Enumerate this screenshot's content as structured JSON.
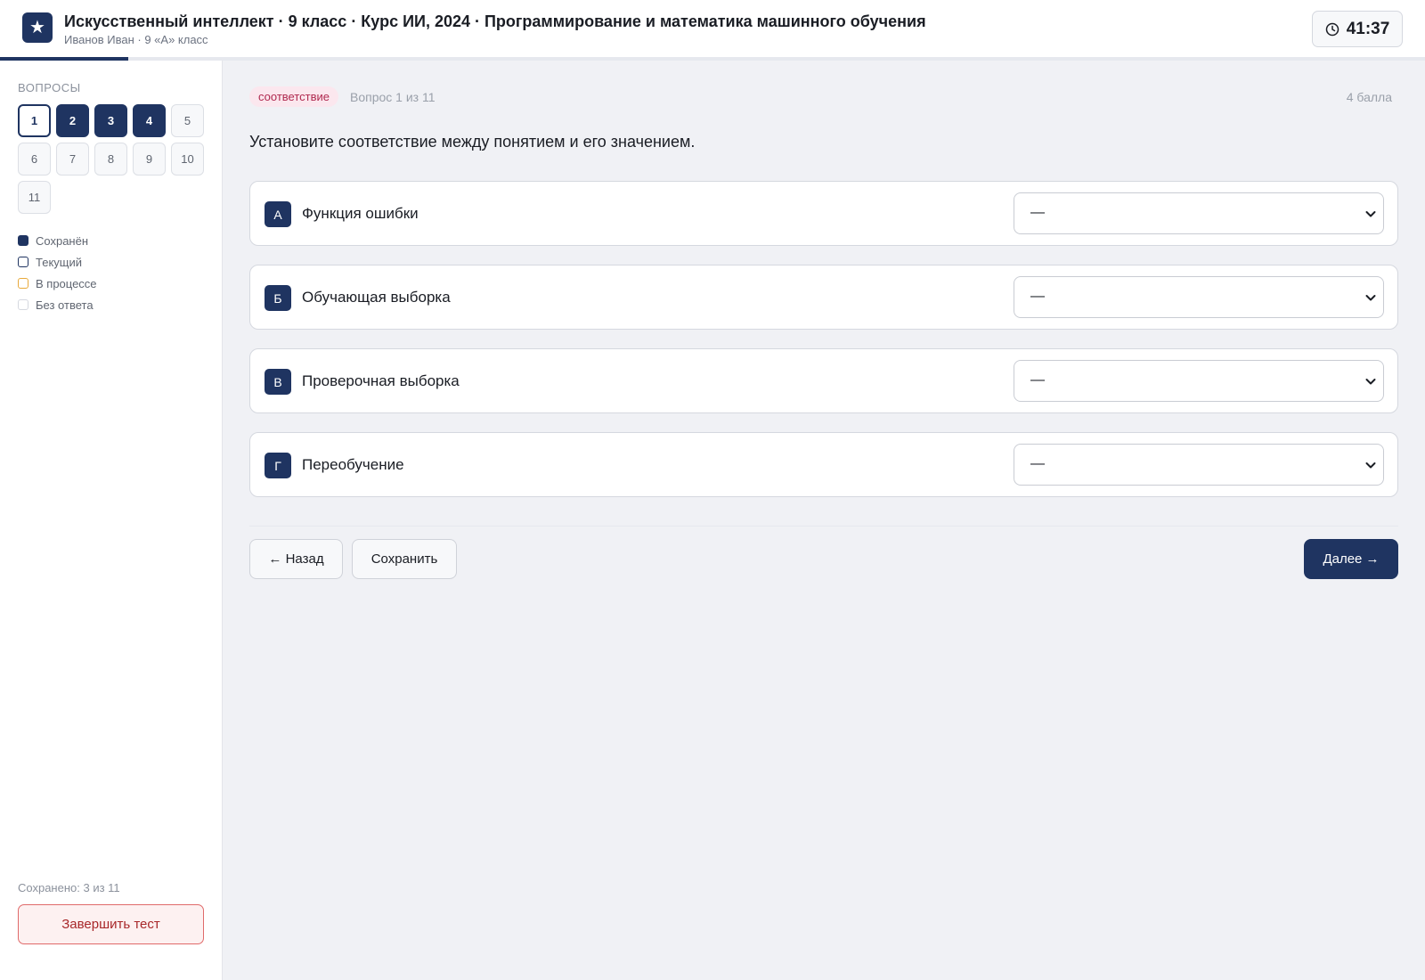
{
  "header": {
    "title": "Искусственный интеллект · 9 класс · Курс ИИ, 2024 · Программирование и математика машинного обучения",
    "subtitle": "Иванов Иван · 9 «А» класс",
    "logo_icon": "star-icon",
    "timer": "41:37",
    "progress": 0.09
  },
  "sidebar": {
    "heading": "ВОПРОСЫ",
    "questions": [
      {
        "label": "1",
        "state": "current"
      },
      {
        "label": "2",
        "state": "saved"
      },
      {
        "label": "3",
        "state": "saved"
      },
      {
        "label": "4",
        "state": "saved"
      },
      {
        "label": "5",
        "state": "empty"
      },
      {
        "label": "6",
        "state": "empty"
      },
      {
        "label": "7",
        "state": "empty"
      },
      {
        "label": "8",
        "state": "empty"
      },
      {
        "label": "9",
        "state": "empty"
      },
      {
        "label": "10",
        "state": "empty"
      },
      {
        "label": "11",
        "state": "empty"
      }
    ],
    "legend": [
      {
        "label": "Сохранён",
        "kind": "saved"
      },
      {
        "label": "Текущий",
        "kind": "current"
      },
      {
        "label": "В процессе",
        "kind": "progress"
      },
      {
        "label": "Без ответа",
        "kind": "empty"
      }
    ],
    "saved_count": "Сохранено: 3 из 11",
    "finish_label": "Завершить тест"
  },
  "question": {
    "type_tag": "соответствие",
    "counter": "Вопрос 1 из 11",
    "points": "4 балла",
    "text": "Установите соответствие между понятием и его значением.",
    "rows": [
      {
        "letter": "А",
        "concept": "Функция ошибки",
        "selected": "—"
      },
      {
        "letter": "Б",
        "concept": "Обучающая выборка",
        "selected": "—"
      },
      {
        "letter": "В",
        "concept": "Проверочная выборка",
        "selected": "—"
      },
      {
        "letter": "Г",
        "concept": "Переобучение",
        "selected": "—"
      }
    ]
  },
  "nav": {
    "back_label": "← Назад",
    "save_label": "Сохранить",
    "next_label": "Далее →"
  },
  "colors": {
    "primary": "#1f3461",
    "tag_bg": "#fbe7ee",
    "tag_text": "#b0294f",
    "danger": "#a8282a",
    "in_progress": "#e8a93a"
  }
}
